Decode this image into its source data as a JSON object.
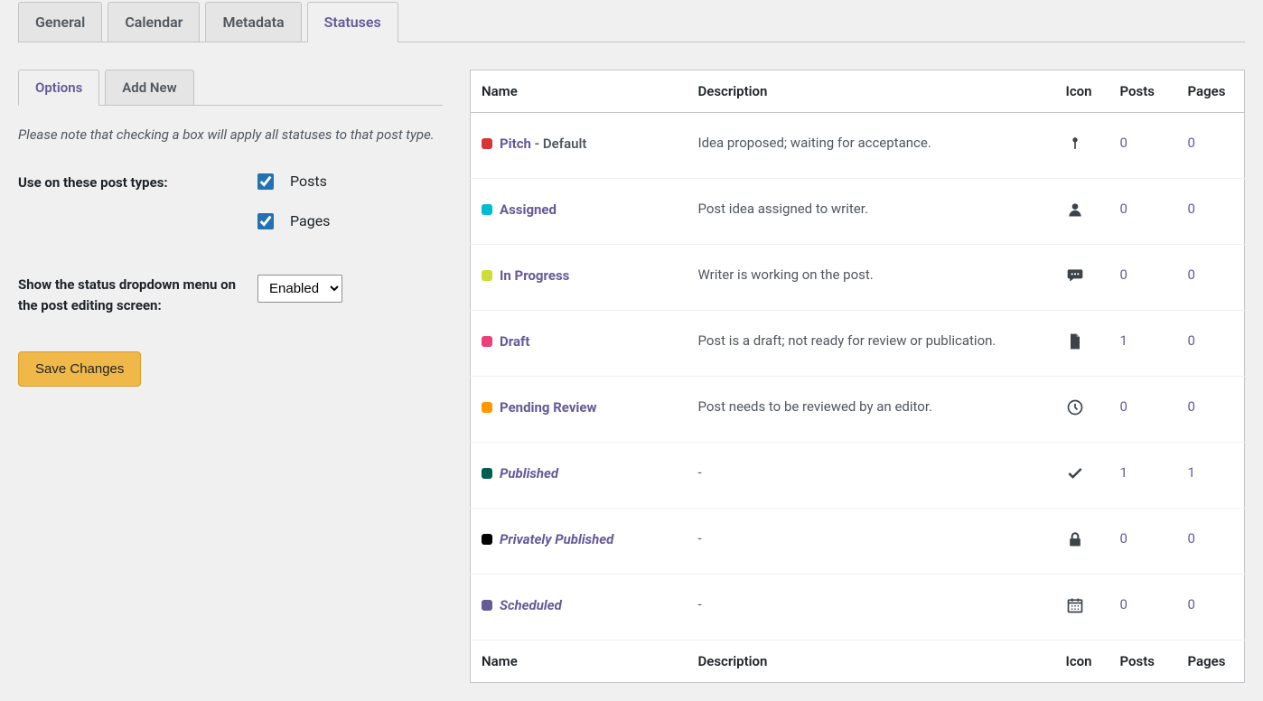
{
  "main_tabs": [
    {
      "label": "General",
      "active": false
    },
    {
      "label": "Calendar",
      "active": false
    },
    {
      "label": "Metadata",
      "active": false
    },
    {
      "label": "Statuses",
      "active": true
    }
  ],
  "sub_tabs": [
    {
      "label": "Options",
      "active": true
    },
    {
      "label": "Add New",
      "active": false
    }
  ],
  "note": "Please note that checking a box will apply all statuses to that post type.",
  "settings": {
    "post_types_label": "Use on these post types:",
    "post_types": [
      {
        "label": "Posts",
        "checked": true
      },
      {
        "label": "Pages",
        "checked": true
      }
    ],
    "dropdown_label": "Show the status dropdown menu on the post editing screen:",
    "dropdown_value": "Enabled",
    "save_label": "Save Changes"
  },
  "table": {
    "headers": {
      "name": "Name",
      "description": "Description",
      "icon": "Icon",
      "posts": "Posts",
      "pages": "Pages"
    },
    "rows": [
      {
        "color": "#d63638",
        "name": "Pitch",
        "default_suffix": " - Default",
        "italic": false,
        "description": "Idea proposed; waiting for acceptance.",
        "icon": "pin",
        "posts": "0",
        "pages": "0"
      },
      {
        "color": "#00bcd4",
        "name": "Assigned",
        "default_suffix": "",
        "italic": false,
        "description": "Post idea assigned to writer.",
        "icon": "user",
        "posts": "0",
        "pages": "0"
      },
      {
        "color": "#cddc39",
        "name": "In Progress",
        "default_suffix": "",
        "italic": false,
        "description": "Writer is working on the post.",
        "icon": "chat",
        "posts": "0",
        "pages": "0"
      },
      {
        "color": "#ec407a",
        "name": "Draft",
        "default_suffix": "",
        "italic": false,
        "description": "Post is a draft; not ready for review or publication.",
        "icon": "document",
        "posts": "1",
        "pages": "0"
      },
      {
        "color": "#ff9800",
        "name": "Pending Review",
        "default_suffix": "",
        "italic": false,
        "description": "Post needs to be reviewed by an editor.",
        "icon": "clock",
        "posts": "0",
        "pages": "0"
      },
      {
        "color": "#006050",
        "name": "Published",
        "default_suffix": "",
        "italic": true,
        "description": "-",
        "icon": "check",
        "posts": "1",
        "pages": "1"
      },
      {
        "color": "#000000",
        "name": "Privately Published",
        "default_suffix": "",
        "italic": true,
        "description": "-",
        "icon": "lock",
        "posts": "0",
        "pages": "0"
      },
      {
        "color": "#655997",
        "name": "Scheduled",
        "default_suffix": "",
        "italic": true,
        "description": "-",
        "icon": "calendar",
        "posts": "0",
        "pages": "0"
      }
    ]
  }
}
